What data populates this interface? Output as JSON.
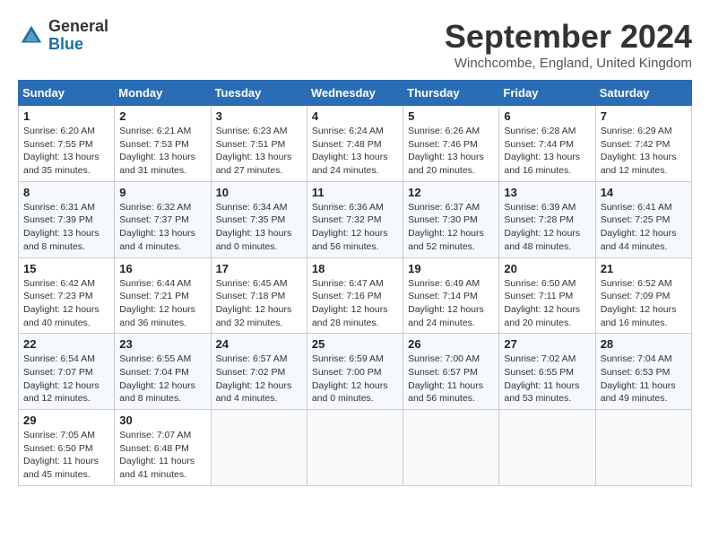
{
  "header": {
    "logo": {
      "line1": "General",
      "line2": "Blue"
    },
    "title": "September 2024",
    "subtitle": "Winchcombe, England, United Kingdom"
  },
  "calendar": {
    "days_of_week": [
      "Sunday",
      "Monday",
      "Tuesday",
      "Wednesday",
      "Thursday",
      "Friday",
      "Saturday"
    ],
    "weeks": [
      [
        {
          "day": 1,
          "sunrise": "6:20 AM",
          "sunset": "7:55 PM",
          "daylight": "13 hours and 35 minutes."
        },
        {
          "day": 2,
          "sunrise": "6:21 AM",
          "sunset": "7:53 PM",
          "daylight": "13 hours and 31 minutes."
        },
        {
          "day": 3,
          "sunrise": "6:23 AM",
          "sunset": "7:51 PM",
          "daylight": "13 hours and 27 minutes."
        },
        {
          "day": 4,
          "sunrise": "6:24 AM",
          "sunset": "7:48 PM",
          "daylight": "13 hours and 24 minutes."
        },
        {
          "day": 5,
          "sunrise": "6:26 AM",
          "sunset": "7:46 PM",
          "daylight": "13 hours and 20 minutes."
        },
        {
          "day": 6,
          "sunrise": "6:28 AM",
          "sunset": "7:44 PM",
          "daylight": "13 hours and 16 minutes."
        },
        {
          "day": 7,
          "sunrise": "6:29 AM",
          "sunset": "7:42 PM",
          "daylight": "13 hours and 12 minutes."
        }
      ],
      [
        {
          "day": 8,
          "sunrise": "6:31 AM",
          "sunset": "7:39 PM",
          "daylight": "13 hours and 8 minutes."
        },
        {
          "day": 9,
          "sunrise": "6:32 AM",
          "sunset": "7:37 PM",
          "daylight": "13 hours and 4 minutes."
        },
        {
          "day": 10,
          "sunrise": "6:34 AM",
          "sunset": "7:35 PM",
          "daylight": "13 hours and 0 minutes."
        },
        {
          "day": 11,
          "sunrise": "6:36 AM",
          "sunset": "7:32 PM",
          "daylight": "12 hours and 56 minutes."
        },
        {
          "day": 12,
          "sunrise": "6:37 AM",
          "sunset": "7:30 PM",
          "daylight": "12 hours and 52 minutes."
        },
        {
          "day": 13,
          "sunrise": "6:39 AM",
          "sunset": "7:28 PM",
          "daylight": "12 hours and 48 minutes."
        },
        {
          "day": 14,
          "sunrise": "6:41 AM",
          "sunset": "7:25 PM",
          "daylight": "12 hours and 44 minutes."
        }
      ],
      [
        {
          "day": 15,
          "sunrise": "6:42 AM",
          "sunset": "7:23 PM",
          "daylight": "12 hours and 40 minutes."
        },
        {
          "day": 16,
          "sunrise": "6:44 AM",
          "sunset": "7:21 PM",
          "daylight": "12 hours and 36 minutes."
        },
        {
          "day": 17,
          "sunrise": "6:45 AM",
          "sunset": "7:18 PM",
          "daylight": "12 hours and 32 minutes."
        },
        {
          "day": 18,
          "sunrise": "6:47 AM",
          "sunset": "7:16 PM",
          "daylight": "12 hours and 28 minutes."
        },
        {
          "day": 19,
          "sunrise": "6:49 AM",
          "sunset": "7:14 PM",
          "daylight": "12 hours and 24 minutes."
        },
        {
          "day": 20,
          "sunrise": "6:50 AM",
          "sunset": "7:11 PM",
          "daylight": "12 hours and 20 minutes."
        },
        {
          "day": 21,
          "sunrise": "6:52 AM",
          "sunset": "7:09 PM",
          "daylight": "12 hours and 16 minutes."
        }
      ],
      [
        {
          "day": 22,
          "sunrise": "6:54 AM",
          "sunset": "7:07 PM",
          "daylight": "12 hours and 12 minutes."
        },
        {
          "day": 23,
          "sunrise": "6:55 AM",
          "sunset": "7:04 PM",
          "daylight": "12 hours and 8 minutes."
        },
        {
          "day": 24,
          "sunrise": "6:57 AM",
          "sunset": "7:02 PM",
          "daylight": "12 hours and 4 minutes."
        },
        {
          "day": 25,
          "sunrise": "6:59 AM",
          "sunset": "7:00 PM",
          "daylight": "12 hours and 0 minutes."
        },
        {
          "day": 26,
          "sunrise": "7:00 AM",
          "sunset": "6:57 PM",
          "daylight": "11 hours and 56 minutes."
        },
        {
          "day": 27,
          "sunrise": "7:02 AM",
          "sunset": "6:55 PM",
          "daylight": "11 hours and 53 minutes."
        },
        {
          "day": 28,
          "sunrise": "7:04 AM",
          "sunset": "6:53 PM",
          "daylight": "11 hours and 49 minutes."
        }
      ],
      [
        {
          "day": 29,
          "sunrise": "7:05 AM",
          "sunset": "6:50 PM",
          "daylight": "11 hours and 45 minutes."
        },
        {
          "day": 30,
          "sunrise": "7:07 AM",
          "sunset": "6:48 PM",
          "daylight": "11 hours and 41 minutes."
        },
        null,
        null,
        null,
        null,
        null
      ]
    ]
  }
}
